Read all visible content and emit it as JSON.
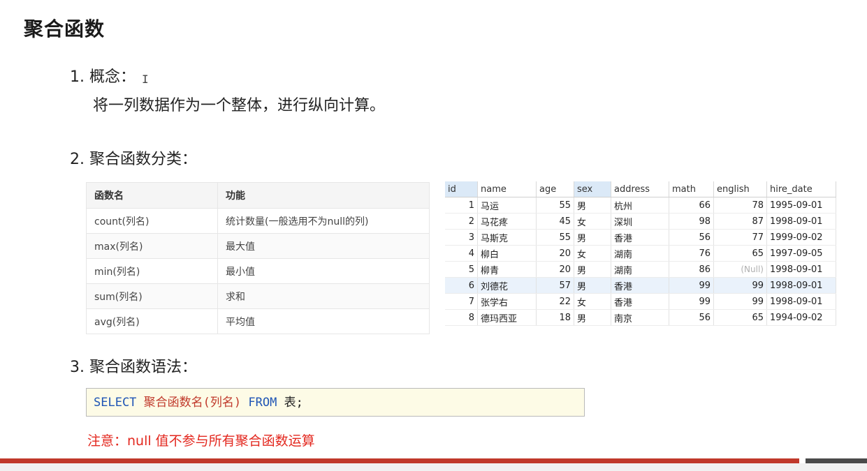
{
  "title": "聚合函数",
  "sections": {
    "concept": {
      "heading": "1.  概念：",
      "text": "将一列数据作为一个整体，进行纵向计算。"
    },
    "categories": {
      "heading": "2. 聚合函数分类："
    },
    "syntax": {
      "heading": "3. 聚合函数语法："
    }
  },
  "function_table": {
    "headers": [
      "函数名",
      "功能"
    ],
    "rows": [
      [
        "count(列名)",
        "统计数量(一般选用不为null的列)"
      ],
      [
        "max(列名)",
        "最大值"
      ],
      [
        "min(列名)",
        "最小值"
      ],
      [
        "sum(列名)",
        "求和"
      ],
      [
        "avg(列名)",
        "平均值"
      ]
    ]
  },
  "data_grid": {
    "columns": [
      "id",
      "name",
      "age",
      "sex",
      "address",
      "math",
      "english",
      "hire_date"
    ],
    "highlighted_columns": [
      "id",
      "sex"
    ],
    "selected_row": 5,
    "rows": [
      [
        "1",
        "马运",
        "55",
        "男",
        "杭州",
        "66",
        "78",
        "1995-09-01"
      ],
      [
        "2",
        "马花疼",
        "45",
        "女",
        "深圳",
        "98",
        "87",
        "1998-09-01"
      ],
      [
        "3",
        "马斯克",
        "55",
        "男",
        "香港",
        "56",
        "77",
        "1999-09-02"
      ],
      [
        "4",
        "柳白",
        "20",
        "女",
        "湖南",
        "76",
        "65",
        "1997-09-05"
      ],
      [
        "5",
        "柳青",
        "20",
        "男",
        "湖南",
        "86",
        "(Null)",
        "1998-09-01"
      ],
      [
        "6",
        "刘德花",
        "57",
        "男",
        "香港",
        "99",
        "99",
        "1998-09-01"
      ],
      [
        "7",
        "张学右",
        "22",
        "女",
        "香港",
        "99",
        "99",
        "1998-09-01"
      ],
      [
        "8",
        "德玛西亚",
        "18",
        "男",
        "南京",
        "56",
        "65",
        "1994-09-02"
      ]
    ]
  },
  "syntax_box": {
    "select_kw": "SELECT",
    "func_placeholder": "聚合函数名(列名)",
    "from_kw": "FROM",
    "table_word": "表;"
  },
  "note": "注意：null 值不参与所有聚合函数运算",
  "cursor_glyph": "I",
  "colors": {
    "note_red": "#e3281f",
    "keyword_blue": "#1f55b5",
    "placeholder_red": "#c0392b",
    "bar_red": "#c0392b"
  }
}
